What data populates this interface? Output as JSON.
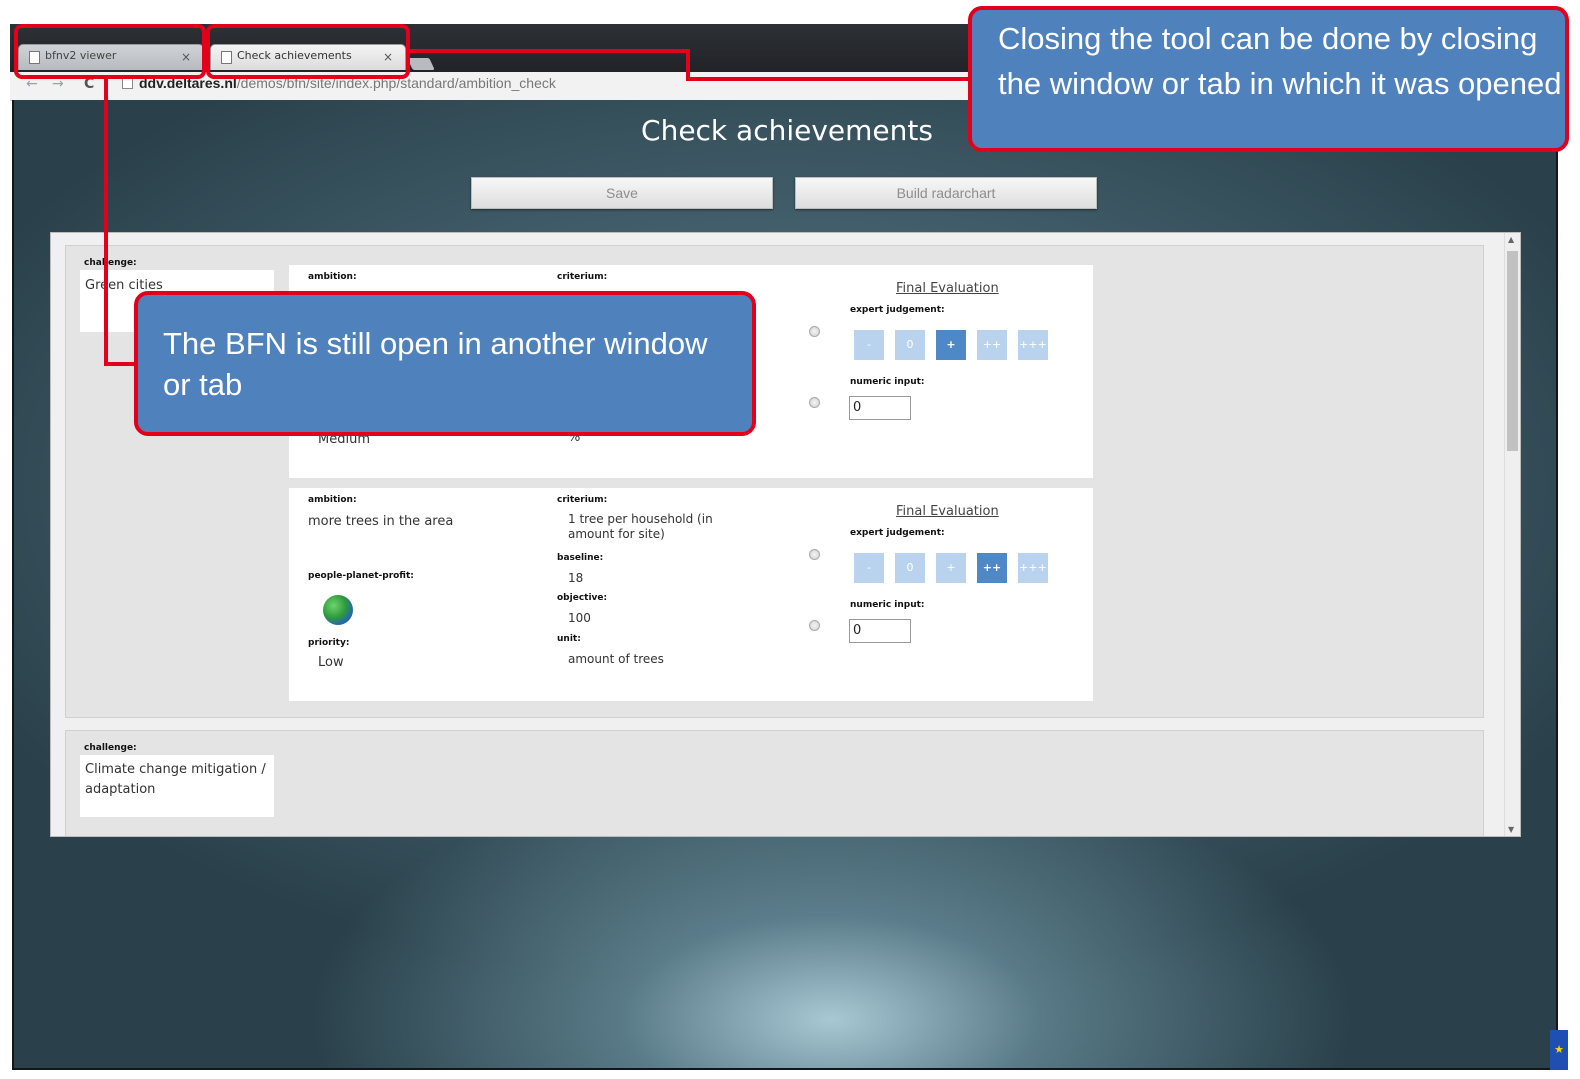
{
  "browser": {
    "tabs": [
      {
        "label": "bfnv2 viewer",
        "close": "×"
      },
      {
        "label": "Check achievements",
        "close": "×"
      }
    ],
    "nav": {
      "back": "←",
      "forward": "→",
      "reload": "C"
    },
    "url": {
      "host": "ddv.deltares.nl",
      "path": "/demos/bfn/site/index.php/standard/ambition_check"
    }
  },
  "page": {
    "title": "Check achievements",
    "save_label": "Save",
    "radar_label": "Build radarchart"
  },
  "labels": {
    "challenge": "challenge:",
    "ambition": "ambition:",
    "criterium": "criterium:",
    "baseline": "baseline:",
    "objective": "objective:",
    "unit": "unit:",
    "ppp": "people-planet-profit:",
    "priority": "priority:",
    "final_evaluation": "Final Evaluation",
    "expert_judgement": "expert judgement:",
    "numeric_input": "numeric input:"
  },
  "judgement_options": [
    "-",
    "0",
    "+",
    "++",
    "+++"
  ],
  "challenges": [
    {
      "name": "Green cities",
      "ambitions": [
        {
          "priority": "Medium",
          "unit": "%",
          "selected_judgement": "+",
          "numeric_value": "0"
        },
        {
          "ambition": "more trees in the area",
          "criterium": "1 tree per household (in amount for site)",
          "baseline": "18",
          "objective": "100",
          "unit": "amount of trees",
          "priority": "Low",
          "ppp_icon": "globe-icon",
          "selected_judgement": "++",
          "numeric_value": "0"
        }
      ]
    },
    {
      "name": "Climate change mitigation / adaptation"
    }
  ],
  "callouts": {
    "close_tool": "Closing the tool can be done by closing the window or tab in which it was opened",
    "bfn_open": "The BFN is still open in another window or tab"
  },
  "colors": {
    "highlight": "#e3001b",
    "callout_bg": "#4f81bd",
    "judgement_active": "#4f88c6",
    "judgement_inactive": "#b9d3ee"
  }
}
